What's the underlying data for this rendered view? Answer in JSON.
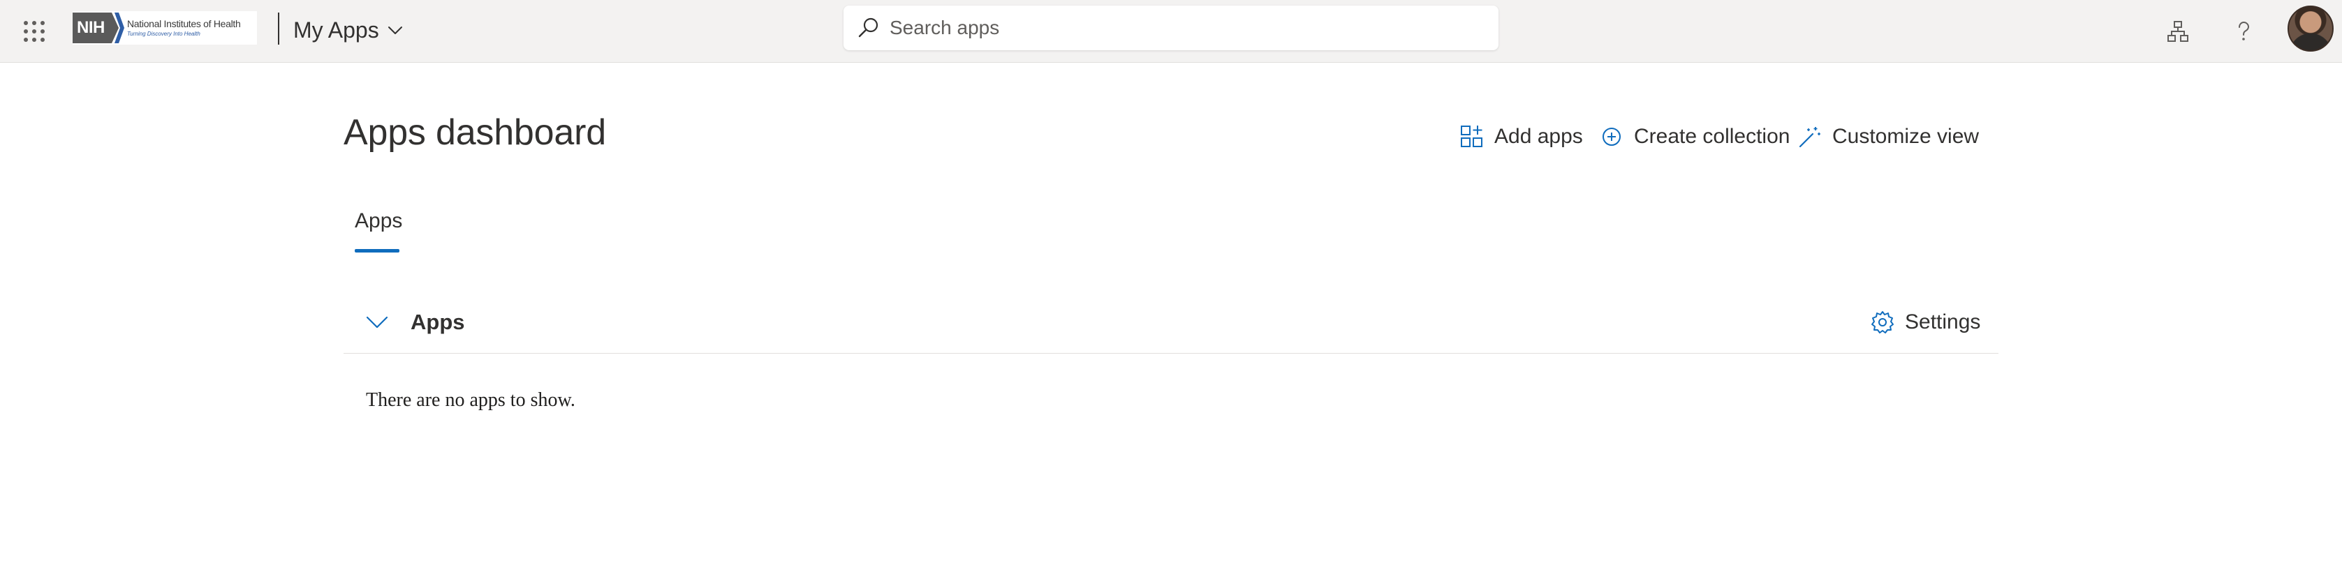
{
  "header": {
    "logo": {
      "mark": "NIH",
      "name": "National Institutes of Health",
      "tagline": "Turning Discovery Into Health"
    },
    "app_switcher_icon": "waffle-icon",
    "app_title": "My Apps",
    "search": {
      "placeholder": "Search apps",
      "value": ""
    },
    "right_icons": [
      "org-chart-icon",
      "help-icon"
    ],
    "avatar": "user-avatar"
  },
  "main": {
    "title": "Apps dashboard",
    "commands": [
      {
        "label": "Add apps",
        "icon": "add-apps-icon"
      },
      {
        "label": "Create collection",
        "icon": "add-circle-icon"
      },
      {
        "label": "Customize view",
        "icon": "magic-wand-icon"
      }
    ],
    "tabs": [
      {
        "label": "Apps",
        "selected": true
      }
    ],
    "section": {
      "title": "Apps",
      "expanded": true,
      "settings_label": "Settings",
      "empty_message": "There are no apps to show."
    }
  },
  "colors": {
    "header_bg": "#f3f2f1",
    "accent": "#0f6cbd",
    "text": "#323130"
  }
}
